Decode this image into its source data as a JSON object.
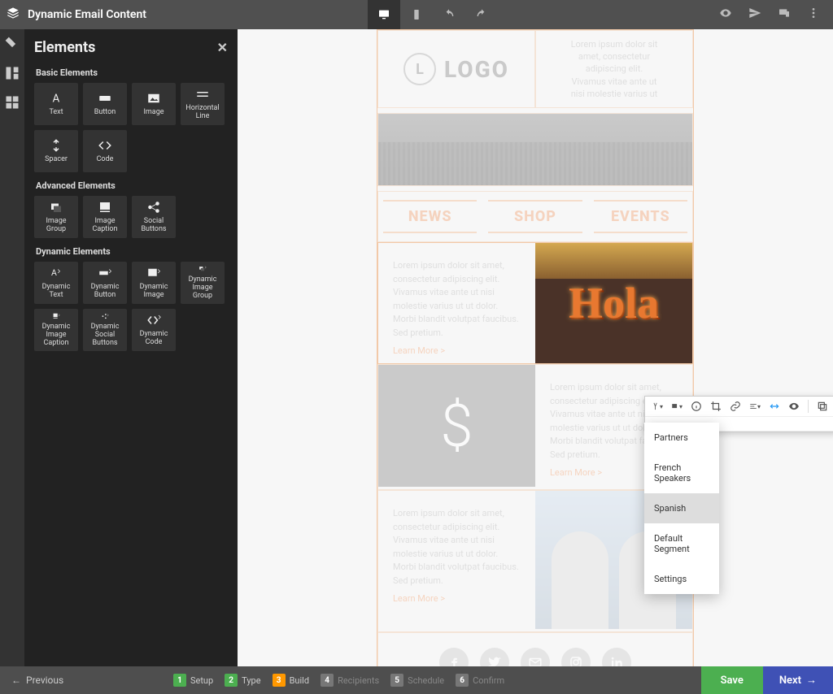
{
  "header": {
    "title": "Dynamic Email Content"
  },
  "panel": {
    "title": "Elements",
    "sections": {
      "basic": {
        "title": "Basic Elements",
        "items": [
          "Text",
          "Button",
          "Image",
          "Horizontal Line",
          "Spacer",
          "Code"
        ]
      },
      "advanced": {
        "title": "Advanced Elements",
        "items": [
          "Image Group",
          "Image Caption",
          "Social Buttons"
        ]
      },
      "dynamic": {
        "title": "Dynamic Elements",
        "items": [
          "Dynamic Text",
          "Dynamic Button",
          "Dynamic Image",
          "Dynamic Image Group",
          "Dynamic Image Caption",
          "Dynamic Social Buttons",
          "Dynamic Code"
        ]
      }
    }
  },
  "email": {
    "logo_text": "LOGO",
    "logo_initial": "L",
    "header_lorem": "Lorem ipsum dolor sit amet, consectetur adipiscing elit. Vivamus vitae ante ut nisi molestie varius ut",
    "nav": [
      "NEWS",
      "SHOP",
      "EVENTS"
    ],
    "block1_text": "Lorem ipsum dolor sit amet, consectetur adipiscing elit. Vivamus vitae ante ut nisi molestie varius ut ut dolor. Morbi blandit volutpat faucibus. Sed pretium.",
    "learn_more": "Learn More >",
    "hola_text": "Hola",
    "block2_text": "Lorem ipsum dolor sit amet, consectetur adipiscing elit. Vivamus vitae ante ut nisi molestie varius ut ut dolor. Morbi blandit volutpat faucibus. Sed pretium.",
    "block3_text": "Lorem ipsum dolor sit amet, consectetur adipiscing elit. Vivamus vitae ante ut nisi molestie varius ut ut dolor. Morbi blandit volutpat faucibus. Sed pretium.",
    "social": [
      "f",
      "t",
      "m",
      "ig",
      "in"
    ]
  },
  "dropdown": {
    "items": [
      "Partners",
      "French Speakers",
      "Spanish",
      "Default Segment",
      "Settings"
    ],
    "selected": "Spanish"
  },
  "footer": {
    "previous": "Previous",
    "steps": [
      {
        "num": "1",
        "label": "Setup",
        "state": "done"
      },
      {
        "num": "2",
        "label": "Type",
        "state": "done"
      },
      {
        "num": "3",
        "label": "Build",
        "state": "active"
      },
      {
        "num": "4",
        "label": "Recipients",
        "state": "future"
      },
      {
        "num": "5",
        "label": "Schedule",
        "state": "future"
      },
      {
        "num": "6",
        "label": "Confirm",
        "state": "future"
      }
    ],
    "save": "Save",
    "next": "Next"
  }
}
